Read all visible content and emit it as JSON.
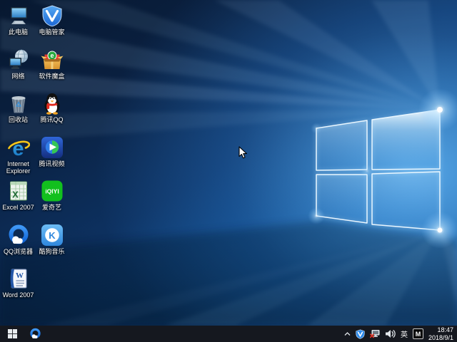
{
  "desktop": {
    "icons": [
      {
        "label": "此电脑",
        "icon": "this-pc-icon"
      },
      {
        "label": "电脑管家",
        "icon": "pc-manager-icon"
      },
      {
        "label": "网络",
        "icon": "network-icon"
      },
      {
        "label": "软件魔盒",
        "icon": "software-box-icon"
      },
      {
        "label": "回收站",
        "icon": "recycle-bin-icon"
      },
      {
        "label": "腾讯QQ",
        "icon": "tencent-qq-icon"
      },
      {
        "label": "Internet Explorer",
        "icon": "internet-explorer-icon"
      },
      {
        "label": "腾讯视频",
        "icon": "tencent-video-icon"
      },
      {
        "label": "Excel 2007",
        "icon": "excel-icon"
      },
      {
        "label": "爱奇艺",
        "icon": "iqiyi-icon"
      },
      {
        "label": "QQ浏览器",
        "icon": "qq-browser-icon"
      },
      {
        "label": "酷狗音乐",
        "icon": "kugou-music-icon"
      },
      {
        "label": "Word 2007",
        "icon": "word-icon"
      }
    ]
  },
  "taskbar": {
    "start_icon": "windows-start-icon",
    "pinned": [
      {
        "icon": "qq-browser-icon"
      }
    ],
    "tray": {
      "chevron_icon": "chevron-up-icon",
      "shield_icon": "pc-manager-shield-icon",
      "network_icon": "network-disconnected-icon",
      "volume_icon": "speaker-icon",
      "language": "英",
      "ime": "M",
      "time": "18:47",
      "date": "2018/9/1"
    }
  },
  "colors": {
    "wallpaper_accent": "#2e8fe6",
    "taskbar_bg": "#15181f",
    "qq_red": "#e02a1e",
    "iqiyi_green": "#12c01e",
    "shield_blue": "#2f8cec",
    "error_red": "#e03325"
  }
}
